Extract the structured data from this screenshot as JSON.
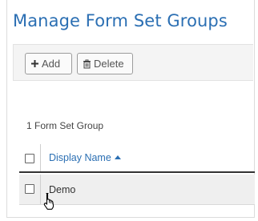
{
  "page": {
    "title": "Manage Form Set Groups"
  },
  "toolbar": {
    "add_label": "Add",
    "add_icon": "plus-icon",
    "delete_label": "Delete",
    "delete_icon": "trash-icon"
  },
  "list": {
    "count_text": "1 Form Set Group",
    "columns": [
      {
        "label": "Display Name",
        "sort": "ascending"
      }
    ],
    "rows": [
      {
        "display_name": "Demo"
      }
    ]
  },
  "colors": {
    "title_blue": "#2b6fb3",
    "toolbar_bg": "#f4f4f4",
    "row_hover": "#efefef"
  }
}
